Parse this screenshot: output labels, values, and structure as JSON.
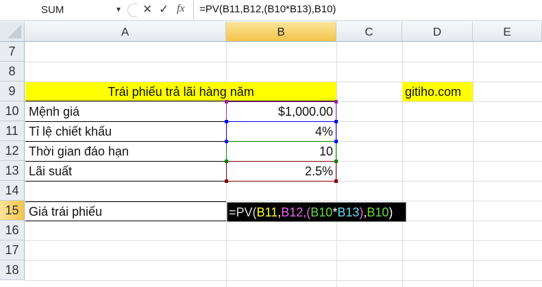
{
  "formula_bar": {
    "name_box": "SUM",
    "cancel_icon": "✕",
    "enter_icon": "✓",
    "fx_label": "fx",
    "formula": "=PV(B11,B12,(B10*B13),B10)"
  },
  "columns": [
    "A",
    "B",
    "C",
    "D",
    "E"
  ],
  "rows": [
    "7",
    "8",
    "9",
    "10",
    "11",
    "12",
    "13",
    "14",
    "15",
    "16",
    "17",
    "18"
  ],
  "cells": {
    "A9": "Trái phiếu trả lãi hàng năm",
    "D9": "gitiho.com",
    "A10": "Mệnh giá",
    "B10": "$1,000.00",
    "A11": "Tỉ lệ chiết khấu",
    "B11": "4%",
    "A12": "Thời gian đáo hạn",
    "B12": "10",
    "A13": "Lãi suất",
    "B13": "2.5%",
    "A15": "Giá trái phiếu"
  },
  "edit_formula": {
    "p0": "=PV(",
    "p1": "B11",
    ",": ",",
    "p2": "B12",
    "p3": ",(",
    "p4": "B10",
    "p5": "*",
    "p6": "B13",
    "p7": ")",
    "p8": ",",
    "p9": "B10",
    "p10": ")"
  },
  "colors": {
    "highlight": "#ffff00",
    "ref1": "#ffff33",
    "ref2": "#ee66ee",
    "ref3": "#66dd44",
    "ref4": "#66ddee",
    "b10": "#a020a0",
    "b11": "#0000ff",
    "b12": "#008000",
    "b13": "#800000"
  }
}
